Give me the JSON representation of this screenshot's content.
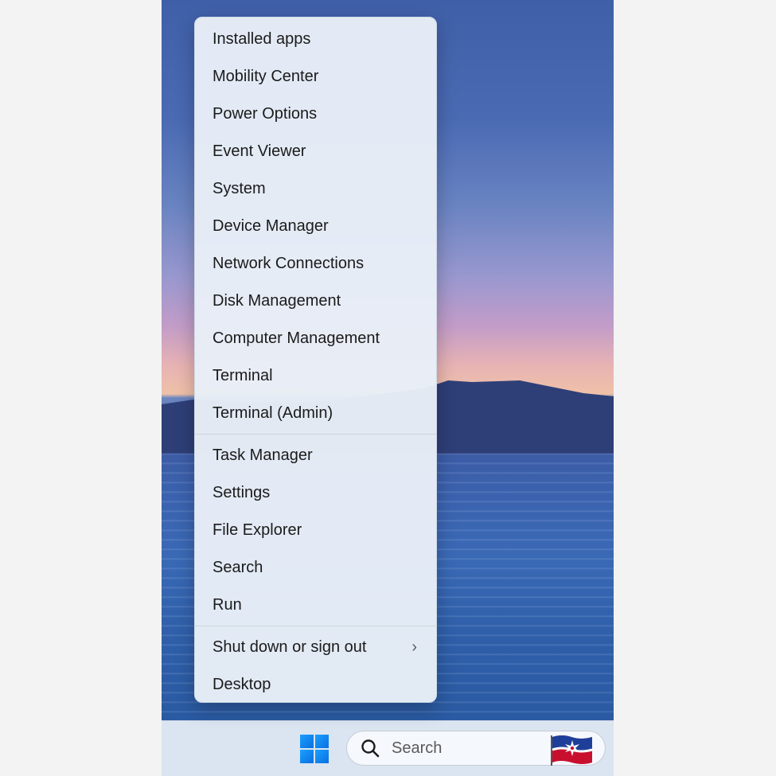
{
  "menu": {
    "group1": [
      {
        "label": "Installed apps"
      },
      {
        "label": "Mobility Center"
      },
      {
        "label": "Power Options"
      },
      {
        "label": "Event Viewer"
      },
      {
        "label": "System"
      },
      {
        "label": "Device Manager"
      },
      {
        "label": "Network Connections"
      },
      {
        "label": "Disk Management"
      },
      {
        "label": "Computer Management"
      },
      {
        "label": "Terminal"
      },
      {
        "label": "Terminal (Admin)"
      }
    ],
    "group2": [
      {
        "label": "Task Manager"
      },
      {
        "label": "Settings"
      },
      {
        "label": "File Explorer"
      },
      {
        "label": "Search"
      },
      {
        "label": "Run"
      }
    ],
    "group3": [
      {
        "label": "Shut down or sign out",
        "submenu_icon": "chevron-right-icon"
      },
      {
        "label": "Desktop"
      }
    ]
  },
  "taskbar": {
    "start_icon": "windows-logo-icon",
    "search": {
      "placeholder": "Search",
      "icon": "search-icon",
      "badge_icon": "flag-icon"
    }
  },
  "colors": {
    "accent": "#0a6fe0",
    "menu_bg": "#e8eef7",
    "taskbar_bg": "#dbe5f1"
  }
}
